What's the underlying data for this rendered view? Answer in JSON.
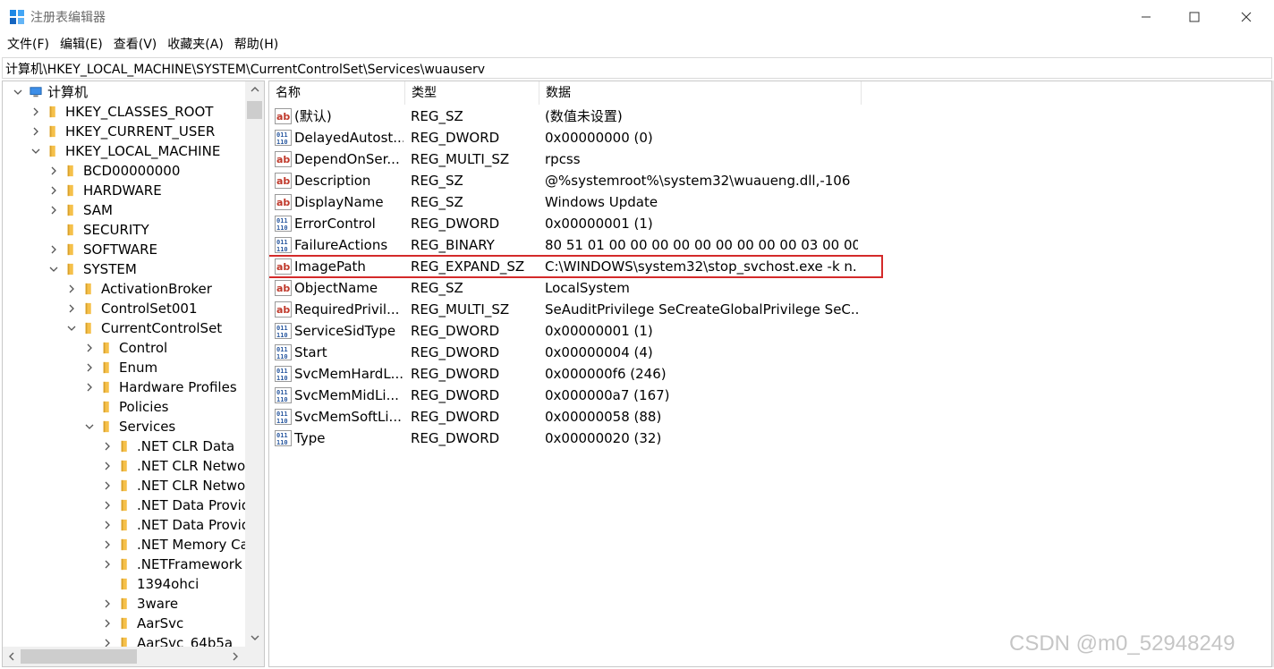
{
  "window": {
    "title": "注册表编辑器"
  },
  "menu": [
    "文件(F)",
    "编辑(E)",
    "查看(V)",
    "收藏夹(A)",
    "帮助(H)"
  ],
  "address": "计算机\\HKEY_LOCAL_MACHINE\\SYSTEM\\CurrentControlSet\\Services\\wuauserv",
  "tree": [
    {
      "label": "计算机",
      "level": 0,
      "expand": "open",
      "icon": "computer-icon"
    },
    {
      "label": "HKEY_CLASSES_ROOT",
      "level": 1,
      "expand": "closed",
      "icon": "folder-icon"
    },
    {
      "label": "HKEY_CURRENT_USER",
      "level": 1,
      "expand": "closed",
      "icon": "folder-icon"
    },
    {
      "label": "HKEY_LOCAL_MACHINE",
      "level": 1,
      "expand": "open",
      "icon": "folder-icon"
    },
    {
      "label": "BCD00000000",
      "level": 2,
      "expand": "closed",
      "icon": "folder-icon"
    },
    {
      "label": "HARDWARE",
      "level": 2,
      "expand": "closed",
      "icon": "folder-icon"
    },
    {
      "label": "SAM",
      "level": 2,
      "expand": "closed",
      "icon": "folder-icon"
    },
    {
      "label": "SECURITY",
      "level": 2,
      "expand": "none",
      "icon": "folder-icon"
    },
    {
      "label": "SOFTWARE",
      "level": 2,
      "expand": "closed",
      "icon": "folder-icon"
    },
    {
      "label": "SYSTEM",
      "level": 2,
      "expand": "open",
      "icon": "folder-icon"
    },
    {
      "label": "ActivationBroker",
      "level": 3,
      "expand": "closed",
      "icon": "folder-icon"
    },
    {
      "label": "ControlSet001",
      "level": 3,
      "expand": "closed",
      "icon": "folder-icon"
    },
    {
      "label": "CurrentControlSet",
      "level": 3,
      "expand": "open",
      "icon": "folder-icon"
    },
    {
      "label": "Control",
      "level": 4,
      "expand": "closed",
      "icon": "folder-icon"
    },
    {
      "label": "Enum",
      "level": 4,
      "expand": "closed",
      "icon": "folder-icon"
    },
    {
      "label": "Hardware Profiles",
      "level": 4,
      "expand": "closed",
      "icon": "folder-icon"
    },
    {
      "label": "Policies",
      "level": 4,
      "expand": "none",
      "icon": "folder-icon"
    },
    {
      "label": "Services",
      "level": 4,
      "expand": "open",
      "icon": "folder-icon"
    },
    {
      "label": ".NET CLR Data",
      "level": 5,
      "expand": "closed",
      "icon": "folder-icon"
    },
    {
      "label": ".NET CLR Networ",
      "level": 5,
      "expand": "closed",
      "icon": "folder-icon"
    },
    {
      "label": ".NET CLR Networ",
      "level": 5,
      "expand": "closed",
      "icon": "folder-icon"
    },
    {
      "label": ".NET Data Provid",
      "level": 5,
      "expand": "closed",
      "icon": "folder-icon"
    },
    {
      "label": ".NET Data Provid",
      "level": 5,
      "expand": "closed",
      "icon": "folder-icon"
    },
    {
      "label": ".NET Memory Ca",
      "level": 5,
      "expand": "closed",
      "icon": "folder-icon"
    },
    {
      "label": ".NETFramework",
      "level": 5,
      "expand": "closed",
      "icon": "folder-icon"
    },
    {
      "label": "1394ohci",
      "level": 5,
      "expand": "none",
      "icon": "folder-icon"
    },
    {
      "label": "3ware",
      "level": 5,
      "expand": "closed",
      "icon": "folder-icon"
    },
    {
      "label": "AarSvc",
      "level": 5,
      "expand": "closed",
      "icon": "folder-icon"
    },
    {
      "label": "AarSvc_64b5a",
      "level": 5,
      "expand": "closed",
      "icon": "folder-icon"
    }
  ],
  "columns": {
    "name": "名称",
    "type": "类型",
    "data": "数据"
  },
  "values": [
    {
      "name": "(默认)",
      "type": "REG_SZ",
      "data": "(数值未设置)",
      "icon": "string-value-icon"
    },
    {
      "name": "DelayedAutost...",
      "type": "REG_DWORD",
      "data": "0x00000000 (0)",
      "icon": "binary-value-icon"
    },
    {
      "name": "DependOnSer...",
      "type": "REG_MULTI_SZ",
      "data": "rpcss",
      "icon": "string-value-icon"
    },
    {
      "name": "Description",
      "type": "REG_SZ",
      "data": "@%systemroot%\\system32\\wuaueng.dll,-106",
      "icon": "string-value-icon"
    },
    {
      "name": "DisplayName",
      "type": "REG_SZ",
      "data": "Windows Update",
      "icon": "string-value-icon"
    },
    {
      "name": "ErrorControl",
      "type": "REG_DWORD",
      "data": "0x00000001 (1)",
      "icon": "binary-value-icon"
    },
    {
      "name": "FailureActions",
      "type": "REG_BINARY",
      "data": "80 51 01 00 00 00 00 00 00 00 00 00 03 00 00 ...",
      "icon": "binary-value-icon"
    },
    {
      "name": "ImagePath",
      "type": "REG_EXPAND_SZ",
      "data": "C:\\WINDOWS\\system32\\stop_svchost.exe -k n...",
      "icon": "string-value-icon"
    },
    {
      "name": "ObjectName",
      "type": "REG_SZ",
      "data": "LocalSystem",
      "icon": "string-value-icon"
    },
    {
      "name": "RequiredPrivil...",
      "type": "REG_MULTI_SZ",
      "data": "SeAuditPrivilege SeCreateGlobalPrivilege SeC...",
      "icon": "string-value-icon"
    },
    {
      "name": "ServiceSidType",
      "type": "REG_DWORD",
      "data": "0x00000001 (1)",
      "icon": "binary-value-icon"
    },
    {
      "name": "Start",
      "type": "REG_DWORD",
      "data": "0x00000004 (4)",
      "icon": "binary-value-icon"
    },
    {
      "name": "SvcMemHardL...",
      "type": "REG_DWORD",
      "data": "0x000000f6 (246)",
      "icon": "binary-value-icon"
    },
    {
      "name": "SvcMemMidLi...",
      "type": "REG_DWORD",
      "data": "0x000000a7 (167)",
      "icon": "binary-value-icon"
    },
    {
      "name": "SvcMemSoftLi...",
      "type": "REG_DWORD",
      "data": "0x00000058 (88)",
      "icon": "binary-value-icon"
    },
    {
      "name": "Type",
      "type": "REG_DWORD",
      "data": "0x00000020 (32)",
      "icon": "binary-value-icon"
    }
  ],
  "highlight_row": "ImagePath",
  "watermark": "CSDN @m0_52948249",
  "colors": {
    "highlight_border": "#d42a2a",
    "folder": "#f5c04a",
    "string_icon": "#c0392b",
    "binary_icon": "#2c5aa0"
  }
}
